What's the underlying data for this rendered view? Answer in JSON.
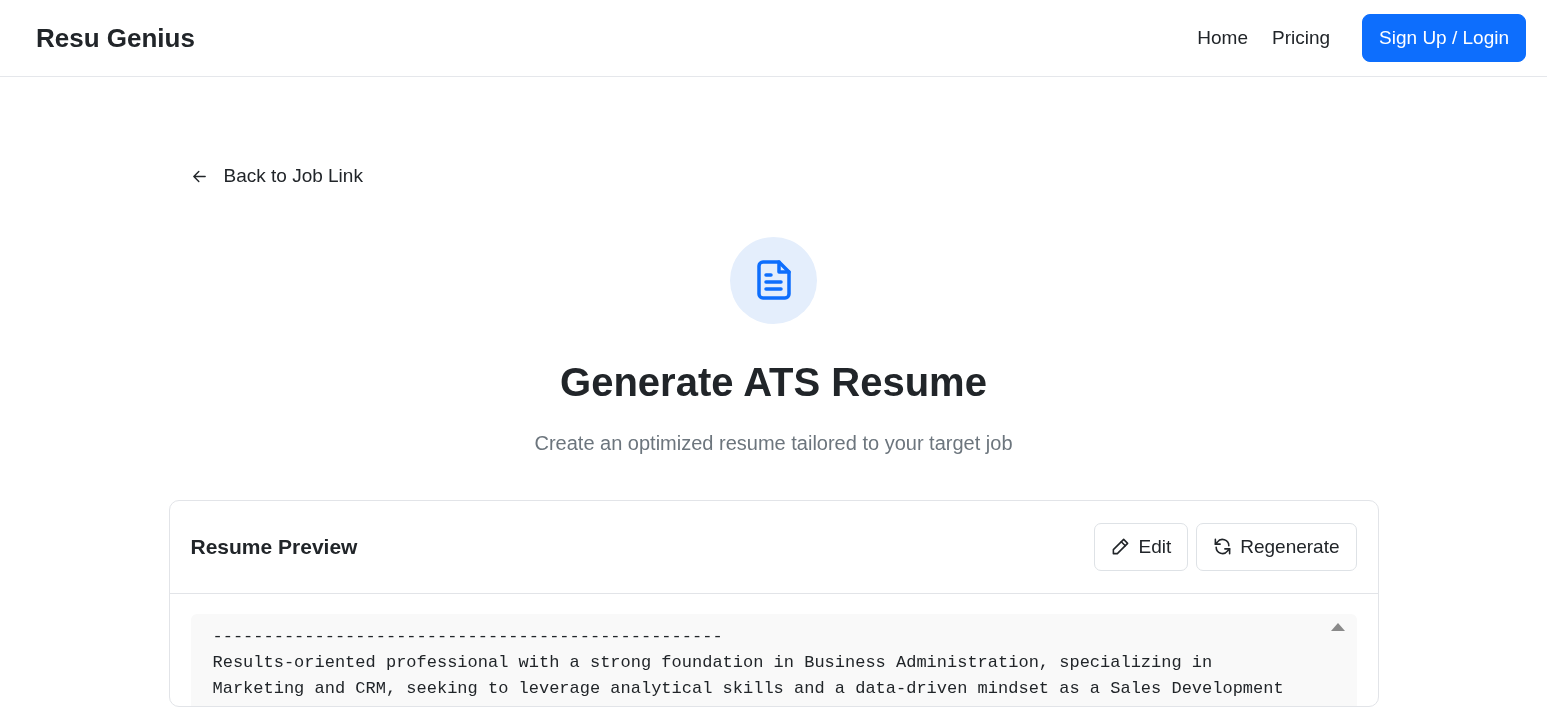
{
  "navbar": {
    "brand": "Resu Genius",
    "links": [
      "Home",
      "Pricing"
    ],
    "cta": "Sign Up / Login"
  },
  "back_link": "Back to Job Link",
  "header": {
    "title": "Generate ATS Resume",
    "subtitle": "Create an optimized resume tailored to your target job"
  },
  "preview": {
    "title": "Resume Preview",
    "actions": [
      {
        "kind": "edit",
        "label": "Edit"
      },
      {
        "kind": "regenerate",
        "label": "Regenerate"
      }
    ],
    "lines": [
      "--------------------------------------------------",
      "Results-oriented professional with a strong foundation in Business Administration, specializing in",
      "Marketing and CRM, seeking to leverage analytical skills and a data-driven mindset as a Sales Development"
    ]
  }
}
